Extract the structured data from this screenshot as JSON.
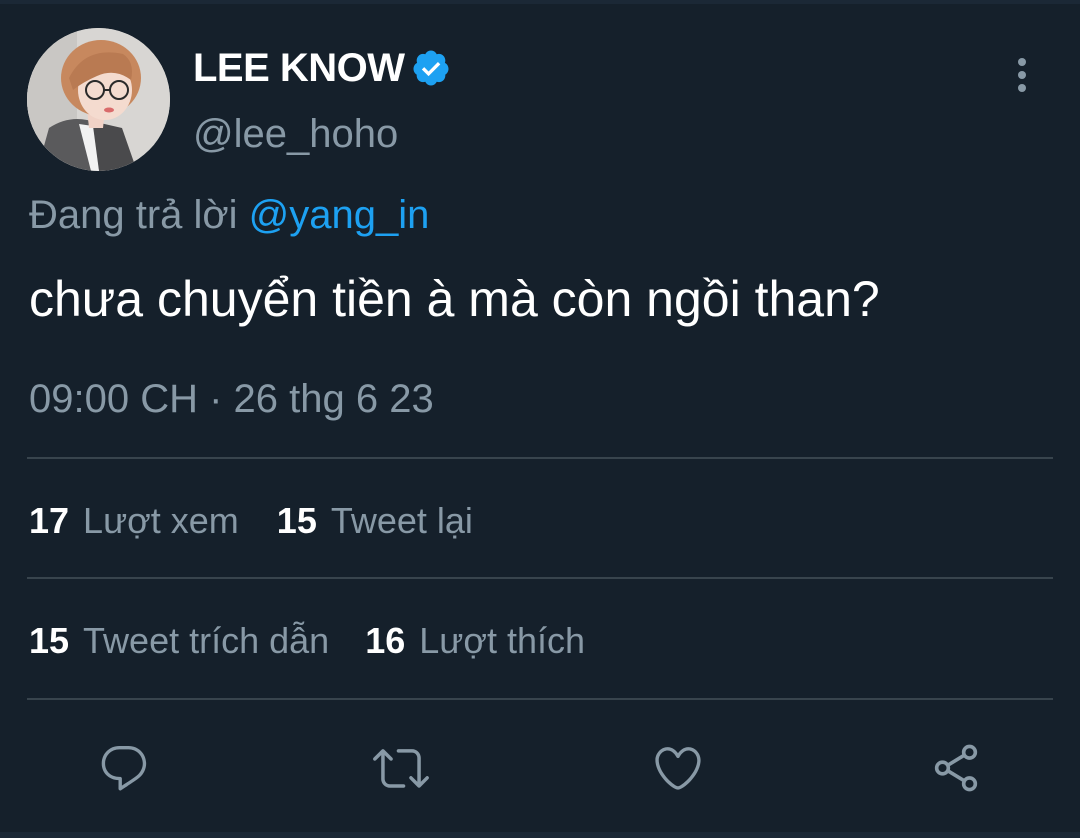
{
  "author": {
    "display_name": "LEE KNOW",
    "handle": "@lee_hoho",
    "verified": true
  },
  "reply": {
    "prefix": "Đang trả lời",
    "mention": "@yang_in"
  },
  "tweet": {
    "text": "chưa chuyển tiền à mà còn ngồi than?",
    "timestamp": "09:00 CH · 26 thg 6 23"
  },
  "stats": {
    "views": {
      "count": "17",
      "label": "Lượt xem"
    },
    "retweets": {
      "count": "15",
      "label": "Tweet lại"
    },
    "quotes": {
      "count": "15",
      "label": "Tweet trích dẫn"
    },
    "likes": {
      "count": "16",
      "label": "Lượt thích"
    }
  },
  "icons": {
    "verified": "verified-badge-icon",
    "more": "more-vertical-icon",
    "reply": "reply-bubble-icon",
    "retweet": "retweet-icon",
    "like": "heart-icon",
    "share": "share-icon"
  },
  "colors": {
    "background": "#15202b",
    "primary_text": "#ffffff",
    "secondary_text": "#8899a6",
    "accent": "#1da1f2",
    "divider": "#38444d"
  }
}
